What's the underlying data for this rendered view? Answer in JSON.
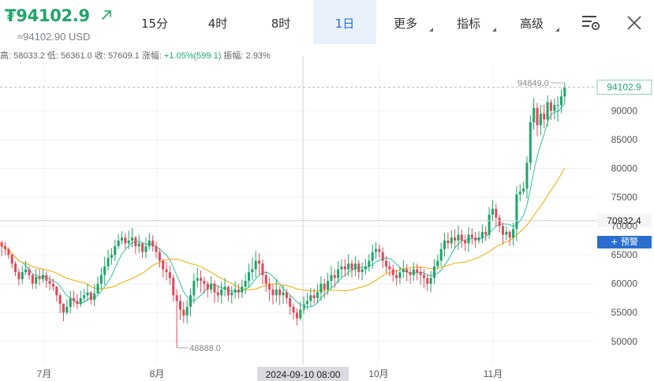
{
  "header": {
    "price": "₮94102.9",
    "usd_price": "≈94102.90 USD",
    "stats_parts": [
      {
        "text": "高: 58033.2 低: 56361.0 收: 57609.1 涨幅: ",
        "up": false
      },
      {
        "text": "+1.05%(599.1)",
        "up": true
      },
      {
        "text": " 振幅: 2.93%",
        "up": false
      }
    ],
    "alert_button": "+ 预警"
  },
  "tabs": [
    {
      "label": "15分",
      "active": false,
      "dropdown": false
    },
    {
      "label": "4时",
      "active": false,
      "dropdown": false
    },
    {
      "label": "8时",
      "active": false,
      "dropdown": false
    },
    {
      "label": "1日",
      "active": true,
      "dropdown": false
    },
    {
      "label": "更多",
      "active": false,
      "dropdown": true
    },
    {
      "label": "指标",
      "active": false,
      "dropdown": true
    },
    {
      "label": "高级",
      "active": false,
      "dropdown": true
    }
  ],
  "icons": {
    "settings": "chart-settings-icon",
    "close": "close-icon",
    "trend": "up-arrow-icon"
  },
  "colors": {
    "up": "#1fa56a",
    "down": "#e04a5a",
    "ma_fast": "#2cc3a0",
    "ma_slow": "#f2b30f",
    "accent": "#2a6fcf"
  },
  "chart_data": {
    "type": "candlestick",
    "title": "",
    "ylim": [
      46000,
      98000
    ],
    "y_ticks": [
      50000,
      55000,
      60000,
      65000,
      70000,
      75000,
      80000,
      85000,
      90000
    ],
    "x_tick_labels": [
      "7月",
      "8月",
      "10月",
      "11月"
    ],
    "last_price_label": "94102.9",
    "crosshair_price_label": "70932.4",
    "crosshair_date_label": "2024-09-10 08:00",
    "max_annotation": "94849.0",
    "min_annotation": "48888.0",
    "series": {
      "close": [
        66500,
        66000,
        65000,
        63500,
        62000,
        60800,
        62000,
        62500,
        61500,
        60000,
        61200,
        60800,
        61500,
        60500,
        60000,
        59500,
        58000,
        56500,
        55000,
        56000,
        57500,
        57000,
        56500,
        57500,
        58000,
        58500,
        57200,
        58300,
        60000,
        61500,
        63000,
        64500,
        65000,
        66500,
        67500,
        68000,
        67000,
        67500,
        68000,
        66500,
        67000,
        65500,
        66500,
        67500,
        66500,
        65500,
        64000,
        62500,
        62000,
        61000,
        58000,
        57000,
        55500,
        54500,
        56000,
        58000,
        60500,
        61000,
        60500,
        60000,
        59000,
        60000,
        58500,
        58000,
        59000,
        59500,
        58000,
        58500,
        59000,
        58500,
        59500,
        60500,
        62000,
        62500,
        64000,
        63500,
        61500,
        60000,
        59000,
        58000,
        59000,
        58000,
        58500,
        57500,
        56000,
        55000,
        54000,
        55500,
        56500,
        57000,
        58000,
        57500,
        58500,
        60000,
        59000,
        60500,
        61500,
        61000,
        62500,
        63000,
        62500,
        63500,
        62500,
        63500,
        62000,
        62500,
        63000,
        64000,
        65500,
        66000,
        65500,
        64000,
        63000,
        62500,
        61500,
        61000,
        62000,
        62500,
        62000,
        61500,
        62500,
        62000,
        61500,
        61000,
        60000,
        61000,
        63000,
        64000,
        66000,
        67500,
        67000,
        68000,
        67500,
        68500,
        67500,
        67000,
        68500,
        68000,
        67500,
        68000,
        69000,
        68500,
        72000,
        73000,
        71500,
        70000,
        68500,
        69000,
        68000,
        69500,
        75500,
        76000,
        76500,
        81000,
        88000,
        90500,
        87500,
        89500,
        88500,
        91500,
        90000,
        91000,
        91000,
        92500,
        94102.9
      ],
      "high": [
        67500,
        67300,
        66300,
        65200,
        63900,
        62600,
        63100,
        64000,
        63000,
        61700,
        62600,
        62600,
        62500,
        62200,
        61400,
        60900,
        59600,
        58400,
        56600,
        57300,
        58800,
        58800,
        58200,
        58800,
        59100,
        60000,
        58700,
        59900,
        61300,
        62800,
        64700,
        65900,
        66200,
        67600,
        68600,
        69100,
        68800,
        69200,
        69700,
        68300,
        68500,
        67200,
        68000,
        68800,
        68400,
        67300,
        66100,
        64300,
        63800,
        63100,
        61600,
        59000,
        58100,
        56900,
        57200,
        59200,
        61800,
        62800,
        62300,
        61200,
        60500,
        61300,
        60600,
        59700,
        60300,
        61000,
        59700,
        59600,
        60400,
        60000,
        60700,
        61800,
        63500,
        64500,
        65700,
        65300,
        64200,
        62200,
        61000,
        59900,
        60800,
        59500,
        59800,
        59100,
        58000,
        56600,
        55700,
        56900,
        57800,
        58400,
        59300,
        59200,
        59900,
        61300,
        60900,
        61900,
        63100,
        62500,
        63900,
        64200,
        64300,
        65100,
        64100,
        64800,
        64100,
        63700,
        64300,
        65100,
        66800,
        67200,
        66800,
        66300,
        64800,
        63900,
        63300,
        62400,
        63000,
        64100,
        63400,
        62600,
        63700,
        63500,
        62900,
        62500,
        61700,
        62200,
        64300,
        65000,
        67100,
        68800,
        68900,
        69300,
        69400,
        70100,
        69400,
        68500,
        69800,
        69600,
        69000,
        69100,
        70300,
        70000,
        73300,
        74500,
        73900,
        72000,
        70700,
        70000,
        69300,
        70600,
        76900,
        77300,
        77700,
        82100,
        89200,
        92200,
        91400,
        91000,
        91100,
        92700,
        92000,
        92100,
        92500,
        93700,
        94849
      ],
      "low": [
        64800,
        65000,
        64300,
        62700,
        61300,
        59700,
        60000,
        61500,
        60700,
        59100,
        59100,
        59700,
        60200,
        59300,
        58900,
        58800,
        56900,
        54900,
        53500,
        54600,
        54900,
        56000,
        55700,
        56000,
        56800,
        57000,
        56400,
        56100,
        58600,
        59000,
        59800,
        62300,
        63300,
        63900,
        66000,
        66800,
        66100,
        66000,
        66300,
        65200,
        65300,
        64500,
        64400,
        65800,
        65600,
        64400,
        62800,
        61100,
        60600,
        59800,
        56900,
        48888,
        53700,
        53200,
        53100,
        54400,
        56600,
        59300,
        58400,
        58300,
        57600,
        58300,
        56700,
        56800,
        56600,
        57800,
        56900,
        56600,
        57500,
        57400,
        57500,
        58200,
        59300,
        60600,
        61100,
        61500,
        59900,
        58600,
        57000,
        56400,
        56800,
        56300,
        56500,
        56500,
        54600,
        53800,
        52800,
        53600,
        54800,
        55500,
        56000,
        56500,
        56600,
        57100,
        57500,
        58100,
        59100,
        59300,
        60100,
        61000,
        61300,
        61300,
        61100,
        61300,
        60800,
        60600,
        61600,
        62100,
        62600,
        64300,
        64500,
        62700,
        61800,
        61300,
        60300,
        59700,
        60000,
        61000,
        60400,
        60000,
        60500,
        60600,
        59800,
        59200,
        58800,
        58500,
        59900,
        62500,
        63000,
        64700,
        66100,
        66100,
        66200,
        65900,
        66200,
        65700,
        65500,
        66800,
        66200,
        67000,
        67000,
        67400,
        67800,
        70800,
        70000,
        68900,
        66900,
        67600,
        66600,
        66600,
        67400,
        74300,
        75400,
        74800,
        79700,
        86700,
        85600,
        85800,
        87000,
        87300,
        88400,
        88500,
        88100,
        89600,
        91200
      ]
    }
  }
}
